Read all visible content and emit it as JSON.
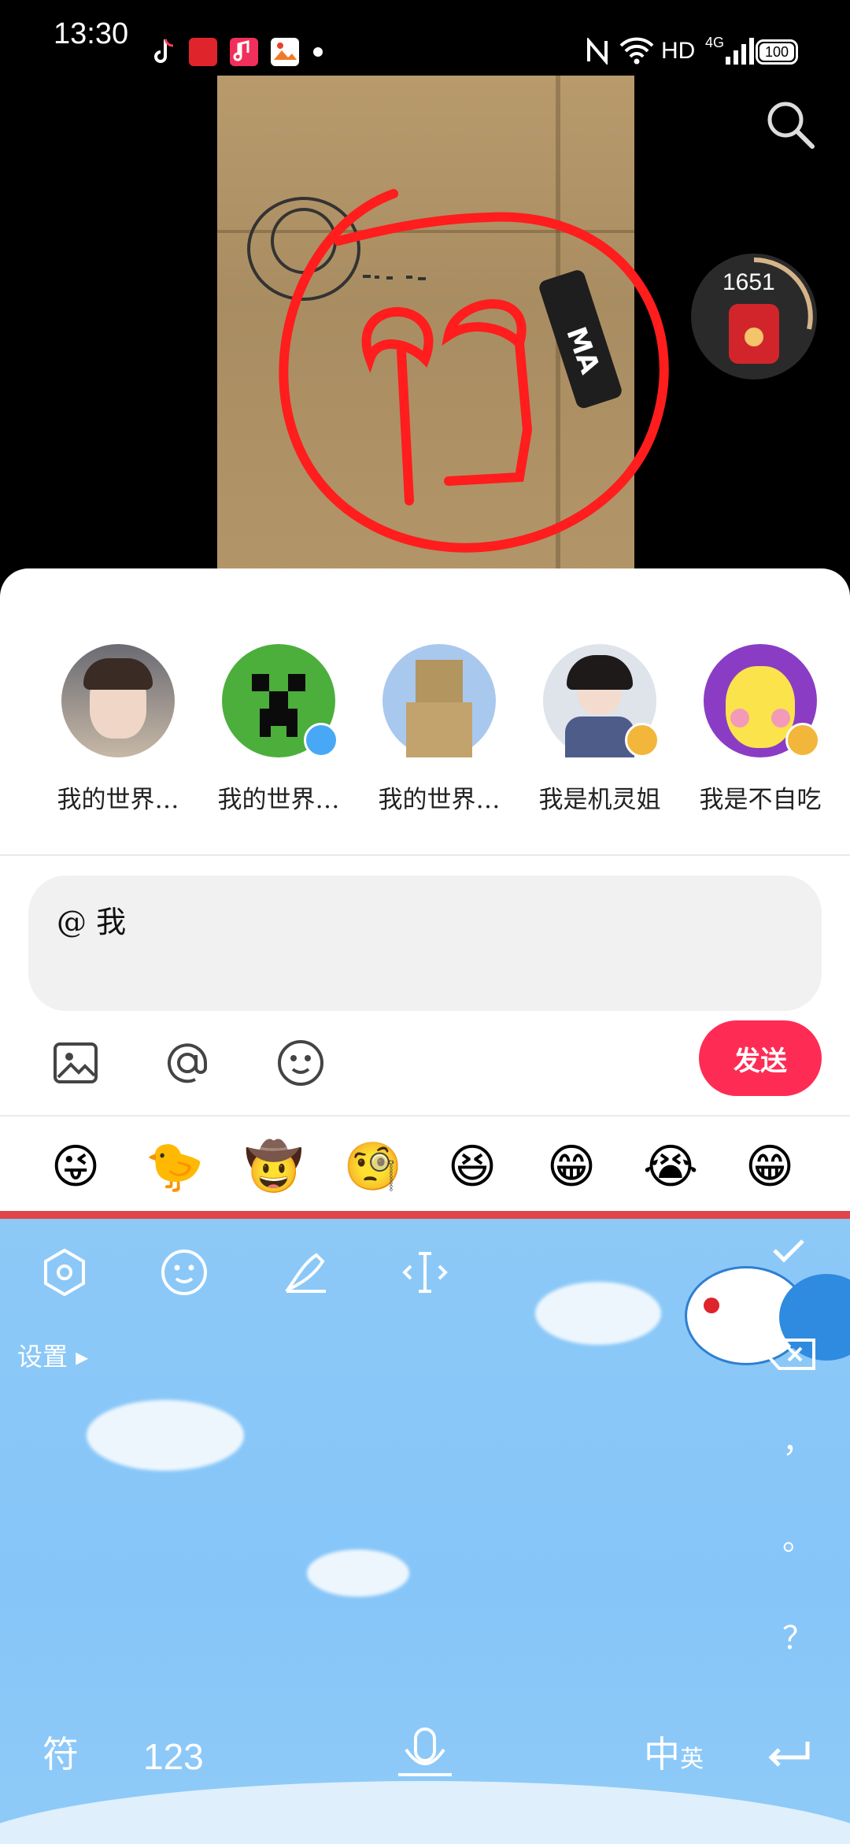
{
  "status_bar": {
    "time": "13:30",
    "network": "HD",
    "cell": "4G",
    "battery": "100",
    "icons": [
      "tiktok-icon",
      "red-app-icon",
      "music-icon",
      "gallery-icon",
      "nfc-icon",
      "wifi-icon",
      "signal-icon",
      "battery-icon"
    ]
  },
  "video": {
    "coin_count": "1651"
  },
  "contacts": [
    {
      "name": "我的世界…",
      "verified": false
    },
    {
      "name": "我的世界…",
      "verified": true
    },
    {
      "name": "我的世界…",
      "verified": false
    },
    {
      "name": "我是机灵姐",
      "verified": true
    },
    {
      "name": "我是不自吃",
      "verified": true
    }
  ],
  "comment": {
    "text": "@ 我"
  },
  "toolbar": {
    "send_label": "发送",
    "icons": [
      "image-icon",
      "at-icon",
      "emoji-icon"
    ]
  },
  "emoji_bar": [
    "😜",
    "🐤",
    "🤠",
    "🧐",
    "😆",
    "😁",
    "😭",
    "😁"
  ],
  "keyboard": {
    "settings_label": "设置 ▸",
    "punctuation": [
      "，",
      "。",
      "？"
    ],
    "symbols_key": "符",
    "numbers_key": "123",
    "lang_key_main": "中",
    "lang_key_sub": "英",
    "accent_color": "#fe2c55"
  }
}
